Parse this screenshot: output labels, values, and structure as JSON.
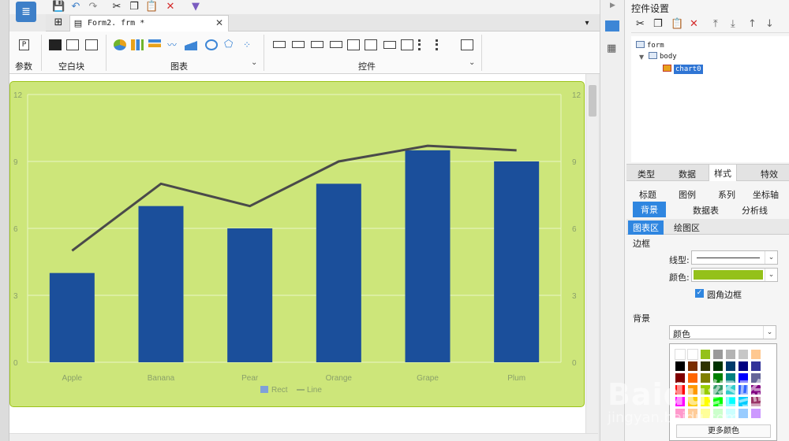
{
  "document": {
    "tab_label": "Form2. frm *"
  },
  "ribbon": {
    "groups": [
      {
        "label": "参数"
      },
      {
        "label": "空白块"
      },
      {
        "label": "图表"
      },
      {
        "label": "控件"
      }
    ]
  },
  "panel": {
    "title": "控件设置",
    "tree": {
      "form": "form",
      "body": "body",
      "chart": "chart0"
    },
    "tabs": [
      "类型",
      "数据",
      "样式",
      "特效"
    ],
    "active_tab": "样式",
    "subtabs_row1": [
      "标题",
      "图例",
      "系列",
      "坐标轴"
    ],
    "subtabs_row2": [
      "背景",
      "数据表",
      "分析线"
    ],
    "active_subtab": "背景",
    "area_tabs": [
      "图表区",
      "绘图区"
    ],
    "active_area_tab": "图表区",
    "border_section": "边框",
    "line_type_label": "线型:",
    "color_label": "颜色:",
    "border_color": "#94c11a",
    "rounded_border_label": "圆角边框",
    "rounded_border_checked": true,
    "background_section": "背景",
    "background_type": "颜色",
    "more_colors": "更多颜色"
  },
  "watermark": {
    "text": "Baidu经验",
    "sub": "jingyan.baidu.com"
  },
  "chart_data": {
    "type": "bar",
    "categories": [
      "Apple",
      "Banana",
      "Pear",
      "Orange",
      "Grape",
      "Plum"
    ],
    "series": [
      {
        "name": "Rect",
        "type": "bar",
        "color": "#1b4f9b",
        "values": [
          4,
          7,
          6,
          8,
          9.5,
          9
        ]
      },
      {
        "name": "Line",
        "type": "line",
        "color": "#4a4a4a",
        "values": [
          5,
          8,
          7,
          9,
          9.7,
          9.5
        ]
      }
    ],
    "yticks": [
      "0",
      "3",
      "6",
      "9",
      "12"
    ],
    "ylim": [
      0,
      12
    ],
    "background": "#cde67a",
    "grid": true,
    "legend": "bottom-center"
  }
}
